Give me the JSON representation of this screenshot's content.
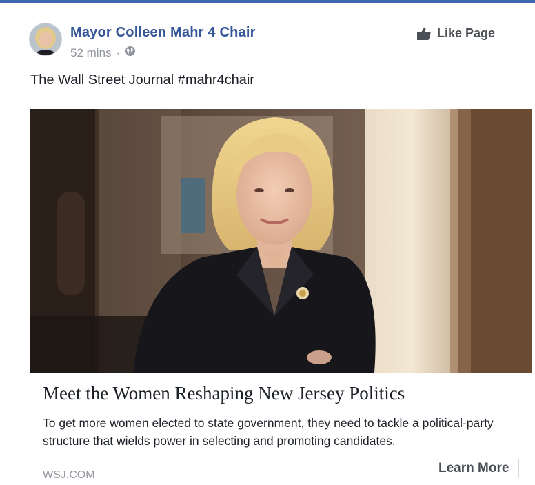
{
  "page": {
    "name": "Mayor Colleen Mahr 4 Chair",
    "timestamp": "52 mins",
    "separator": "·",
    "audience_icon": "globe-icon",
    "like_button_label": "Like Page",
    "like_icon": "thumbs-up-icon"
  },
  "post": {
    "text": "The Wall Street Journal #mahr4chair"
  },
  "link": {
    "title": "Meet the Women Reshaping New Jersey Politics",
    "description": "To get more women elected to state government, they need to tackle a political-party structure that wields power in selecting and promoting candidates.",
    "domain": "WSJ.COM",
    "cta_label": "Learn More"
  },
  "colors": {
    "brand_blue": "#4267b2",
    "page_name": "#365899",
    "muted_text": "#90949c",
    "body_text": "#1d2129"
  }
}
